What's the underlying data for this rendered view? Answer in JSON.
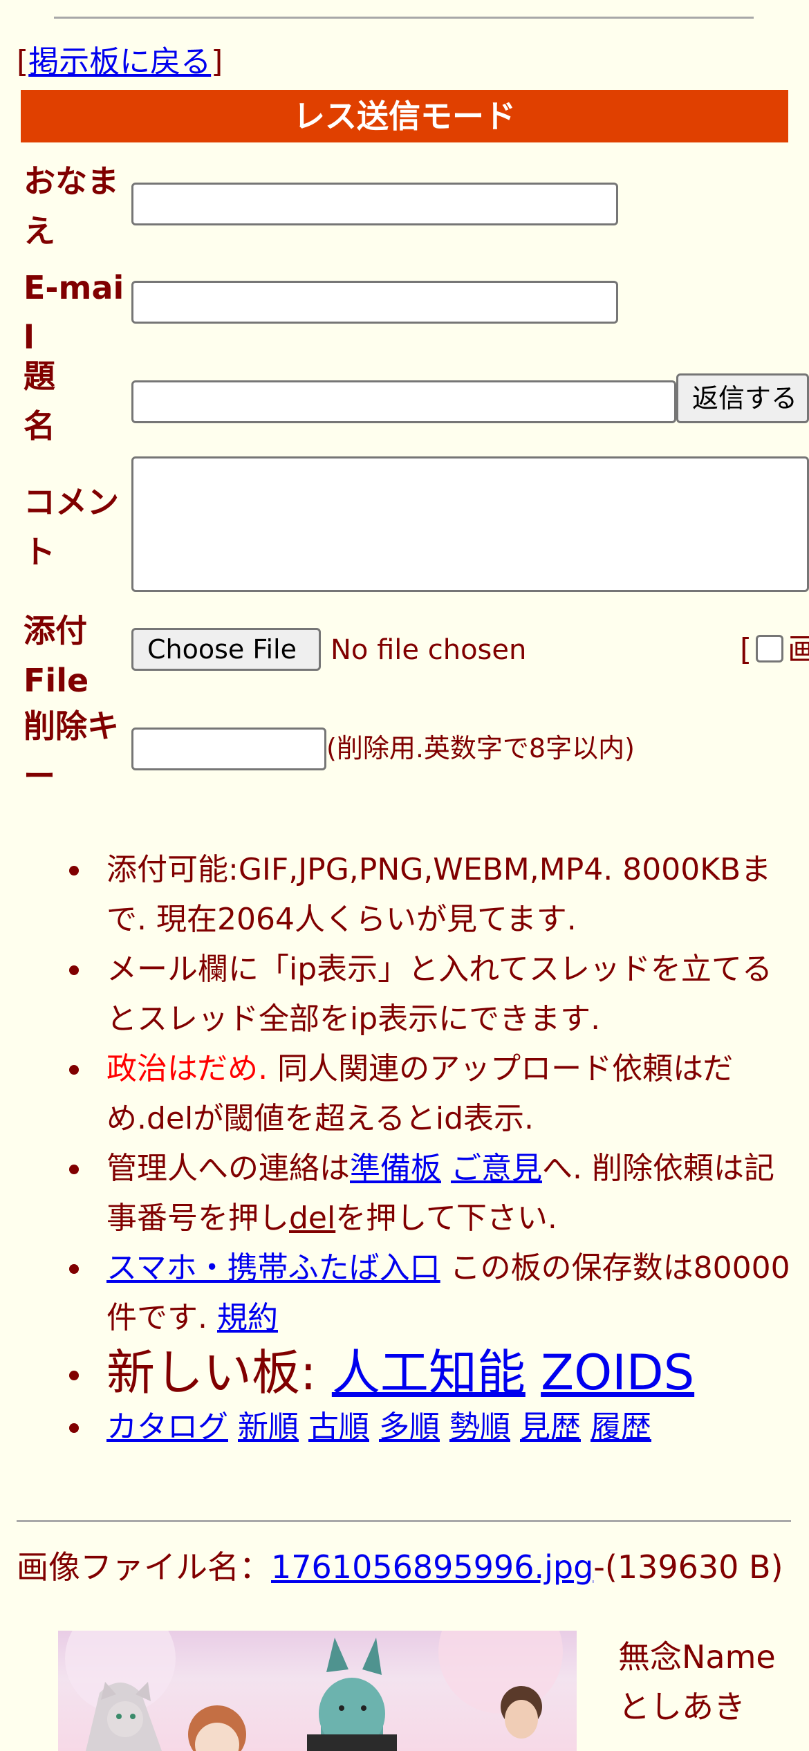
{
  "nav": {
    "back_link": "掲示板に戻る",
    "bracket_open": "[",
    "bracket_close": "]"
  },
  "form": {
    "mode_title": "レス送信モード",
    "name_label": "おなまえ",
    "email_label": "E-mail",
    "subject_label": "題名",
    "submit_button": "返信する",
    "comment_label": "コメント",
    "file_label": "添付File",
    "choose_file_button": "Choose File",
    "no_file_text": "No file chosen",
    "image_option_prefix": "[",
    "image_option_label": "画",
    "delkey_label": "削除キー",
    "delkey_hint": "(削除用.英数字で8字以内)"
  },
  "rules": {
    "r1": "添付可能:GIF,JPG,PNG,WEBM,MP4. 8000KBまで. 現在2064人くらいが見てます.",
    "r2": "メール欄に「ip表示」と入れてスレッドを立てるとスレッド全部をip表示にできます.",
    "r3_red": "政治はだめ.",
    "r3_rest": " 同人関連のアップロード依頼はだめ.delが閾値を超えるとid表示.",
    "r4_a": "管理人への連絡は",
    "r4_link1": "準備板",
    "r4_link2": "ご意見",
    "r4_b": "へ. 削除依頼は記事番号を押し",
    "r4_link3": "del",
    "r4_c": "を押して下さい.",
    "r5_link": "スマホ・携帯ふたば入口",
    "r5_text": " この板の保存数は80000件です. ",
    "r5_link2": "規約",
    "r6_text": "新しい板: ",
    "r6_link1": "人工知能",
    "r6_link2": "ZOIDS",
    "nav_links": [
      "カタログ",
      "新順",
      "古順",
      "多順",
      "勢順",
      "見歴",
      "履歴"
    ]
  },
  "post": {
    "file_prefix": "画像ファイル名：",
    "file_name": "1761056895996.jpg",
    "file_size": "-(139630 B)",
    "name": "無念Name",
    "poster": "としあき"
  },
  "colors": {
    "background": "#ffffee",
    "text": "#800000",
    "mode_bar": "#e04000",
    "link": "#0000ee",
    "warning": "#ff0000"
  }
}
